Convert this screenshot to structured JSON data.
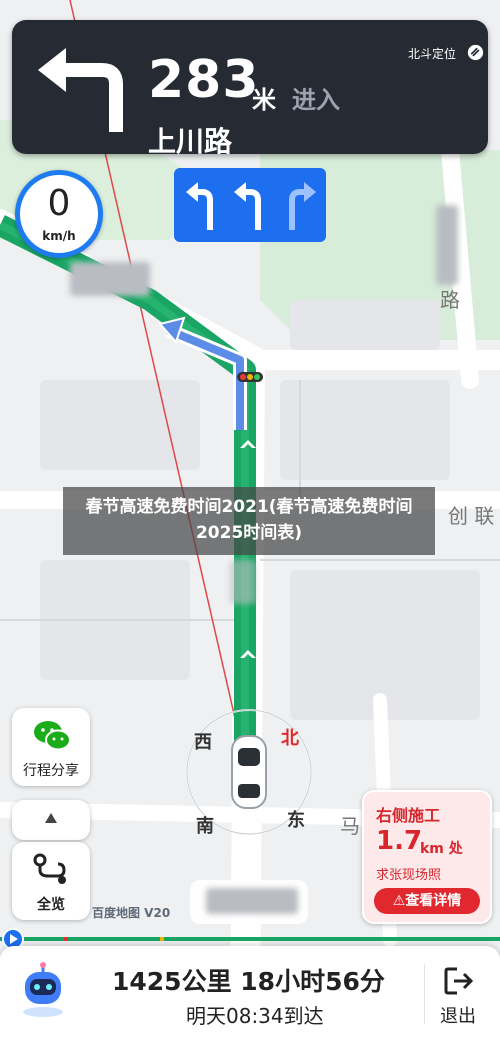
{
  "guidance": {
    "distance_value": "283",
    "distance_unit": "米",
    "action": "进入",
    "road_name": "上川路",
    "positioning_label": "北斗定位"
  },
  "speed": {
    "value": "0",
    "unit": "km/h"
  },
  "lanes": [
    "left-turn-arrow",
    "left-turn-arrow",
    "right-turn-arrow"
  ],
  "compass": {
    "north": "北",
    "west": "西",
    "south": "南",
    "east": "东"
  },
  "map_labels": {
    "road_lu": "路",
    "road_chuang": "创 联",
    "road_ma": "马"
  },
  "side_buttons": {
    "route_share": "行程分享",
    "overview": "全览"
  },
  "alert": {
    "title": "右侧施工",
    "distance": "1.7",
    "unit": "km 处",
    "location": "求张现场照",
    "action": "查看详情"
  },
  "banner": "春节高速免费时间2021(春节高速免费时间2025时间表)",
  "map_logo": "百度地图 V20",
  "bottom_bar": {
    "distance_time": "1425公里 18小时56分",
    "eta": "明天08:34到达",
    "exit_label": "退出"
  },
  "colors": {
    "route_green": "#1aa564",
    "nav_card": "#262b33",
    "accent_blue": "#1d6ff0",
    "alert_red": "#d8262c"
  }
}
